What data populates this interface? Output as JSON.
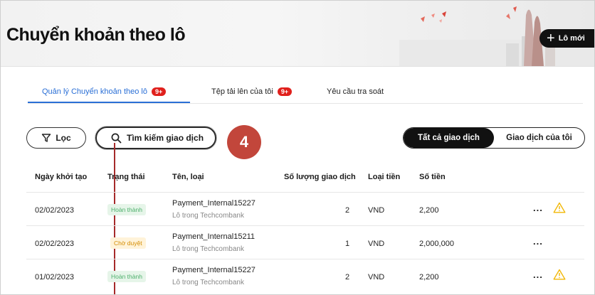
{
  "page": {
    "title": "Chuyển khoản theo lô"
  },
  "header": {
    "new_batch_label": "Lô mới",
    "plus_glyph": "+"
  },
  "tabs": [
    {
      "label": "Quản lý Chuyển khoản theo lô",
      "badge": "9+",
      "active": true
    },
    {
      "label": "Tệp tải lên của tôi",
      "badge": "9+",
      "active": false
    },
    {
      "label": "Yêu cầu tra soát",
      "badge": "",
      "active": false
    }
  ],
  "toolbar": {
    "filter_label": "Lọc",
    "filter_icon": "funnel-icon",
    "search_label": "Tìm kiếm giao dịch",
    "search_icon": "search-icon",
    "step_marker": "4",
    "segments": [
      {
        "label": "Tất cả giao dịch",
        "selected": true
      },
      {
        "label": "Giao dịch của tôi",
        "selected": false
      }
    ]
  },
  "table": {
    "columns": [
      "Ngày khởi tạo",
      "Trạng thái",
      "Tên, loại",
      "Số lượng giao dịch",
      "Loại tiền",
      "Số tiền"
    ],
    "rows": [
      {
        "date": "02/02/2023",
        "status": "Hoàn thành",
        "status_type": "done",
        "name": "Payment_Internal15227",
        "type": "Lô trong Techcombank",
        "count": "2",
        "currency": "VND",
        "amount": "2,200",
        "more": "...",
        "warning": true
      },
      {
        "date": "02/02/2023",
        "status": "Chờ duyệt",
        "status_type": "wait",
        "name": "Payment_Internal15211",
        "type": "Lô trong Techcombank",
        "count": "1",
        "currency": "VND",
        "amount": "2,000,000",
        "more": "...",
        "warning": false
      },
      {
        "date": "01/02/2023",
        "status": "Hoàn thành",
        "status_type": "done",
        "name": "Payment_Internal15227",
        "type": "Lô trong Techcombank",
        "count": "2",
        "currency": "VND",
        "amount": "2,200",
        "more": "...",
        "warning": true
      }
    ]
  },
  "colors": {
    "accent": "#2a6fd6",
    "badge": "#e0201c",
    "marker": "#c2463b",
    "warning": "#f2b705"
  }
}
